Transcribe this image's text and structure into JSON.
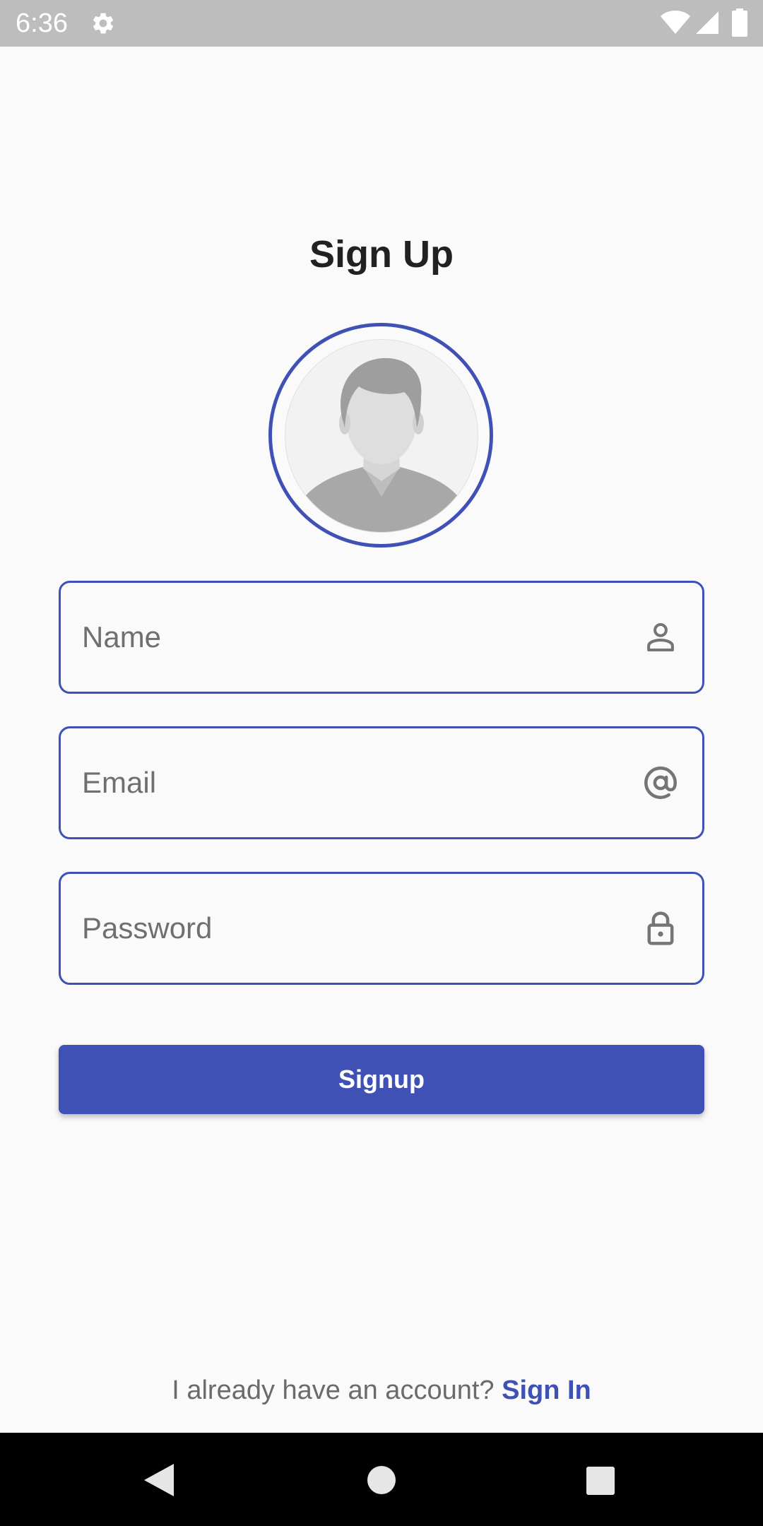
{
  "status_bar": {
    "time": "6:36",
    "icons": [
      "gear-icon",
      "wifi-icon",
      "signal-icon",
      "battery-icon"
    ]
  },
  "title": "Sign Up",
  "avatar": {
    "icon": "person-placeholder-icon"
  },
  "fields": {
    "name": {
      "placeholder": "Name",
      "value": "",
      "icon": "person-outline-icon"
    },
    "email": {
      "placeholder": "Email",
      "value": "",
      "icon": "at-sign-icon"
    },
    "password": {
      "placeholder": "Password",
      "value": "",
      "icon": "lock-icon"
    }
  },
  "signup_button": {
    "label": "Signup"
  },
  "signin": {
    "prompt": "I already have an account?",
    "link": "Sign In"
  },
  "nav_bar": {
    "icons": [
      "back-icon",
      "home-icon",
      "recents-icon"
    ]
  },
  "colors": {
    "accent": "#3f51b5",
    "background": "#fafafa",
    "status_bar": "#bdbdbd",
    "nav_bar": "#000000",
    "placeholder_text": "#6f6f6f",
    "icon_gray": "#757575"
  }
}
